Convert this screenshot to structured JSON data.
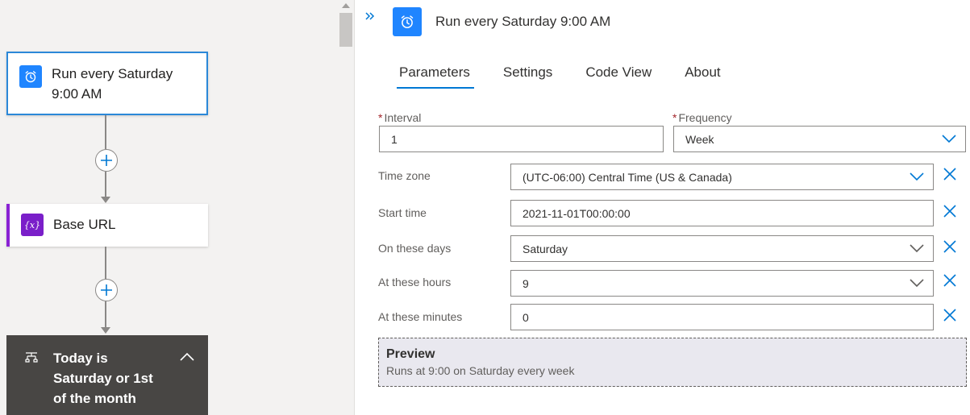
{
  "canvas": {
    "trigger_card": {
      "title": "Run every Saturday 9:00 AM",
      "icon": "alarm-clock-icon"
    },
    "variable_card": {
      "title": "Base URL",
      "icon": "variable-icon",
      "accent": "#8a22d4"
    },
    "condition_card": {
      "title": "Today is Saturday or 1st of the month",
      "icon": "condition-icon"
    }
  },
  "panel": {
    "title": "Run every Saturday 9:00 AM",
    "tabs": [
      {
        "label": "Parameters",
        "active": true
      },
      {
        "label": "Settings",
        "active": false
      },
      {
        "label": "Code View",
        "active": false
      },
      {
        "label": "About",
        "active": false
      }
    ],
    "fields": {
      "interval": {
        "label": "Interval",
        "required": true,
        "value": "1"
      },
      "frequency": {
        "label": "Frequency",
        "required": true,
        "value": "Week"
      },
      "time_zone": {
        "label": "Time zone",
        "value": "(UTC-06:00) Central Time (US & Canada)"
      },
      "start_time": {
        "label": "Start time",
        "value": "2021-11-01T00:00:00"
      },
      "on_these_days": {
        "label": "On these days",
        "value": "Saturday"
      },
      "at_these_hours": {
        "label": "At these hours",
        "value": "9"
      },
      "at_these_minutes": {
        "label": "At these minutes",
        "value": "0"
      }
    },
    "preview": {
      "title": "Preview",
      "text": "Runs at 9:00 on Saturday every week"
    }
  },
  "colors": {
    "accent_blue": "#0078d4",
    "trigger_icon_bg": "#1f85ff",
    "required_star": "#a4262c"
  }
}
